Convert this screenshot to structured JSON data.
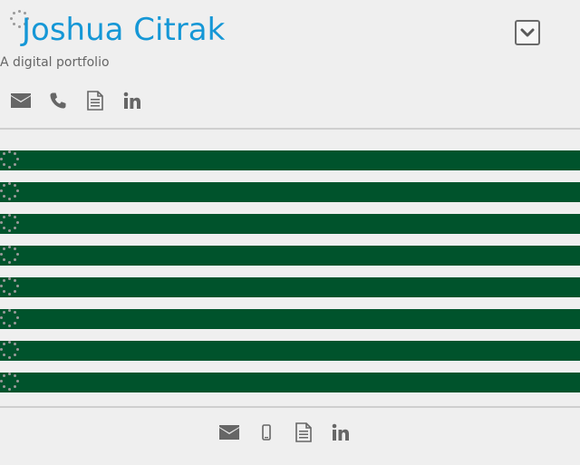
{
  "header": {
    "title": "Joshua Citrak",
    "subtitle": "A digital portfolio",
    "dropdown_icon": "chevron-down-icon"
  },
  "contact_icons": [
    "envelope-icon",
    "phone-icon",
    "document-icon",
    "linkedin-icon"
  ],
  "footer_icons": [
    "envelope-icon",
    "mobile-phone-icon",
    "document-icon",
    "linkedin-icon"
  ],
  "portfolio_items_count": 8,
  "colors": {
    "title": "#1597d6",
    "band": "#00532c",
    "background": "#efefef",
    "icon": "#666666",
    "spinner": "#9a9a9a"
  }
}
